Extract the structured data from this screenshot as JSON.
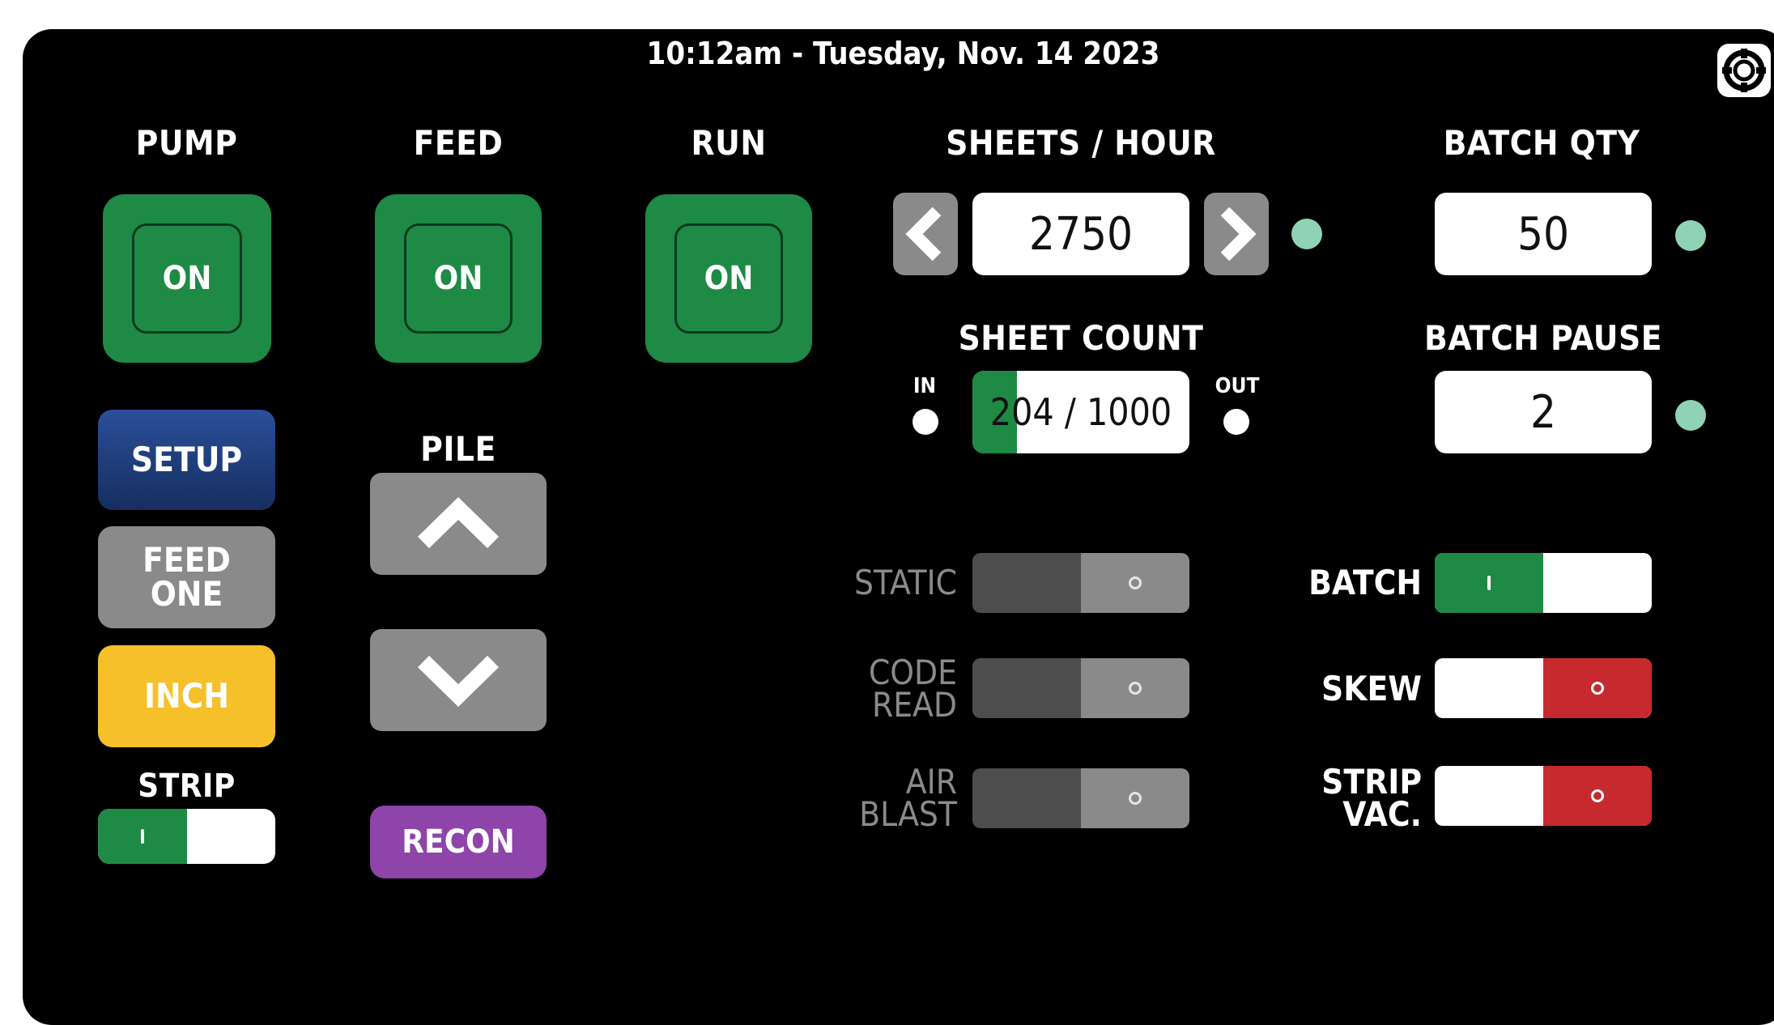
{
  "header": {
    "datetime": "10:12am - Tuesday, Nov. 14 2023"
  },
  "controls": {
    "pump": {
      "label": "PUMP",
      "state": "ON"
    },
    "feed": {
      "label": "FEED",
      "state": "ON"
    },
    "run": {
      "label": "RUN",
      "state": "ON"
    }
  },
  "buttons": {
    "setup": "SETUP",
    "feed_one_line1": "FEED",
    "feed_one_line2": "ONE",
    "inch": "INCH",
    "recon": "RECON"
  },
  "pile": {
    "label": "PILE"
  },
  "strip": {
    "label": "STRIP",
    "on": true
  },
  "sheets_per_hour": {
    "label": "SHEETS / HOUR",
    "value": "2750"
  },
  "batch_qty": {
    "label": "BATCH QTY",
    "value": "50"
  },
  "sheet_count": {
    "label": "SHEET COUNT",
    "value": "204 / 1000",
    "progress": 0.204,
    "in_label": "IN",
    "out_label": "OUT"
  },
  "batch_pause": {
    "label": "BATCH PAUSE",
    "value": "2"
  },
  "toggles": {
    "static": {
      "label": "STATIC",
      "on": false,
      "enabled": false
    },
    "code_read": {
      "line1": "CODE",
      "line2": "READ",
      "on": false,
      "enabled": false
    },
    "air_blast": {
      "line1": "AIR",
      "line2": "BLAST",
      "on": false,
      "enabled": false
    },
    "batch": {
      "label": "BATCH",
      "on": true
    },
    "skew": {
      "label": "SKEW",
      "on": false
    },
    "strip_vac": {
      "line1": "STRIP",
      "line2": "VAC.",
      "on": false
    }
  },
  "icons": {
    "settings": "lifebuoy-gear-icon",
    "left": "chevron-left-icon",
    "right": "chevron-right-icon",
    "up": "chevron-up-icon",
    "down": "chevron-down-icon"
  },
  "colors": {
    "on_green": "#1e8a45",
    "setup_blue": "#1f3f7d",
    "inch_yellow": "#f6c02b",
    "recon_purple": "#8e44a8",
    "off_red": "#c62a2f",
    "led_mint": "#8fd3b4",
    "button_gray": "#8a8a8a"
  }
}
